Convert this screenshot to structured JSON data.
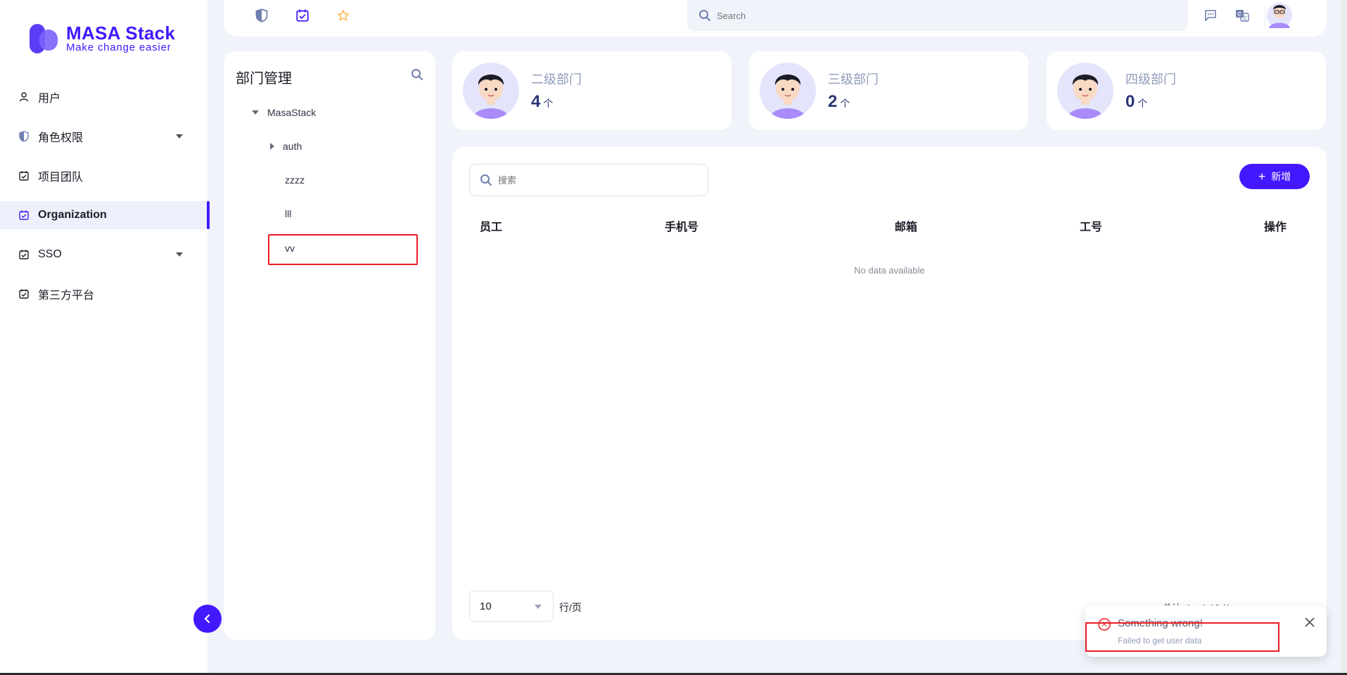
{
  "app": {
    "logo_title": "MASA Stack",
    "logo_tagline": "Make change easier"
  },
  "sidebar": {
    "items": [
      {
        "label": "用户",
        "icon": "user-icon"
      },
      {
        "label": "角色权限",
        "icon": "shield-icon",
        "expandable": true
      },
      {
        "label": "项目团队",
        "icon": "calendar-check-icon"
      },
      {
        "label": "Organization",
        "icon": "calendar-check-icon",
        "active": true
      },
      {
        "label": "SSO",
        "icon": "calendar-check-icon",
        "expandable": true
      },
      {
        "label": "第三方平台",
        "icon": "calendar-check-icon"
      }
    ]
  },
  "topbar": {
    "search_placeholder": "Search"
  },
  "department": {
    "title": "部门管理",
    "tree": [
      {
        "label": "MasaStack",
        "level": 0,
        "toggle": "down"
      },
      {
        "label": "auth",
        "level": 1,
        "toggle": "right"
      },
      {
        "label": "zzzz",
        "level": 1,
        "toggle": "none"
      },
      {
        "label": "lll",
        "level": 1,
        "toggle": "none"
      },
      {
        "label": "vv",
        "level": 1,
        "toggle": "none",
        "highlighted": true
      }
    ]
  },
  "stats": [
    {
      "label": "二级部门",
      "value": "4",
      "unit": "个"
    },
    {
      "label": "三级部门",
      "value": "2",
      "unit": "个"
    },
    {
      "label": "四级部门",
      "value": "0",
      "unit": "个"
    }
  ],
  "table": {
    "search_placeholder": "搜索",
    "add_button": "新增",
    "columns": [
      "员工",
      "手机号",
      "邮箱",
      "工号",
      "操作"
    ],
    "empty_text": "No data available",
    "per_page_value": "10",
    "per_page_label": "行/页",
    "pager_text": "总计: 1   <   1-10 (1   >"
  },
  "toast": {
    "title": "Something wrong!",
    "message": "Failed to get user data"
  },
  "colors": {
    "accent": "#4318ff",
    "highlight_box": "#ec1c24",
    "error": "#f14d4d"
  }
}
